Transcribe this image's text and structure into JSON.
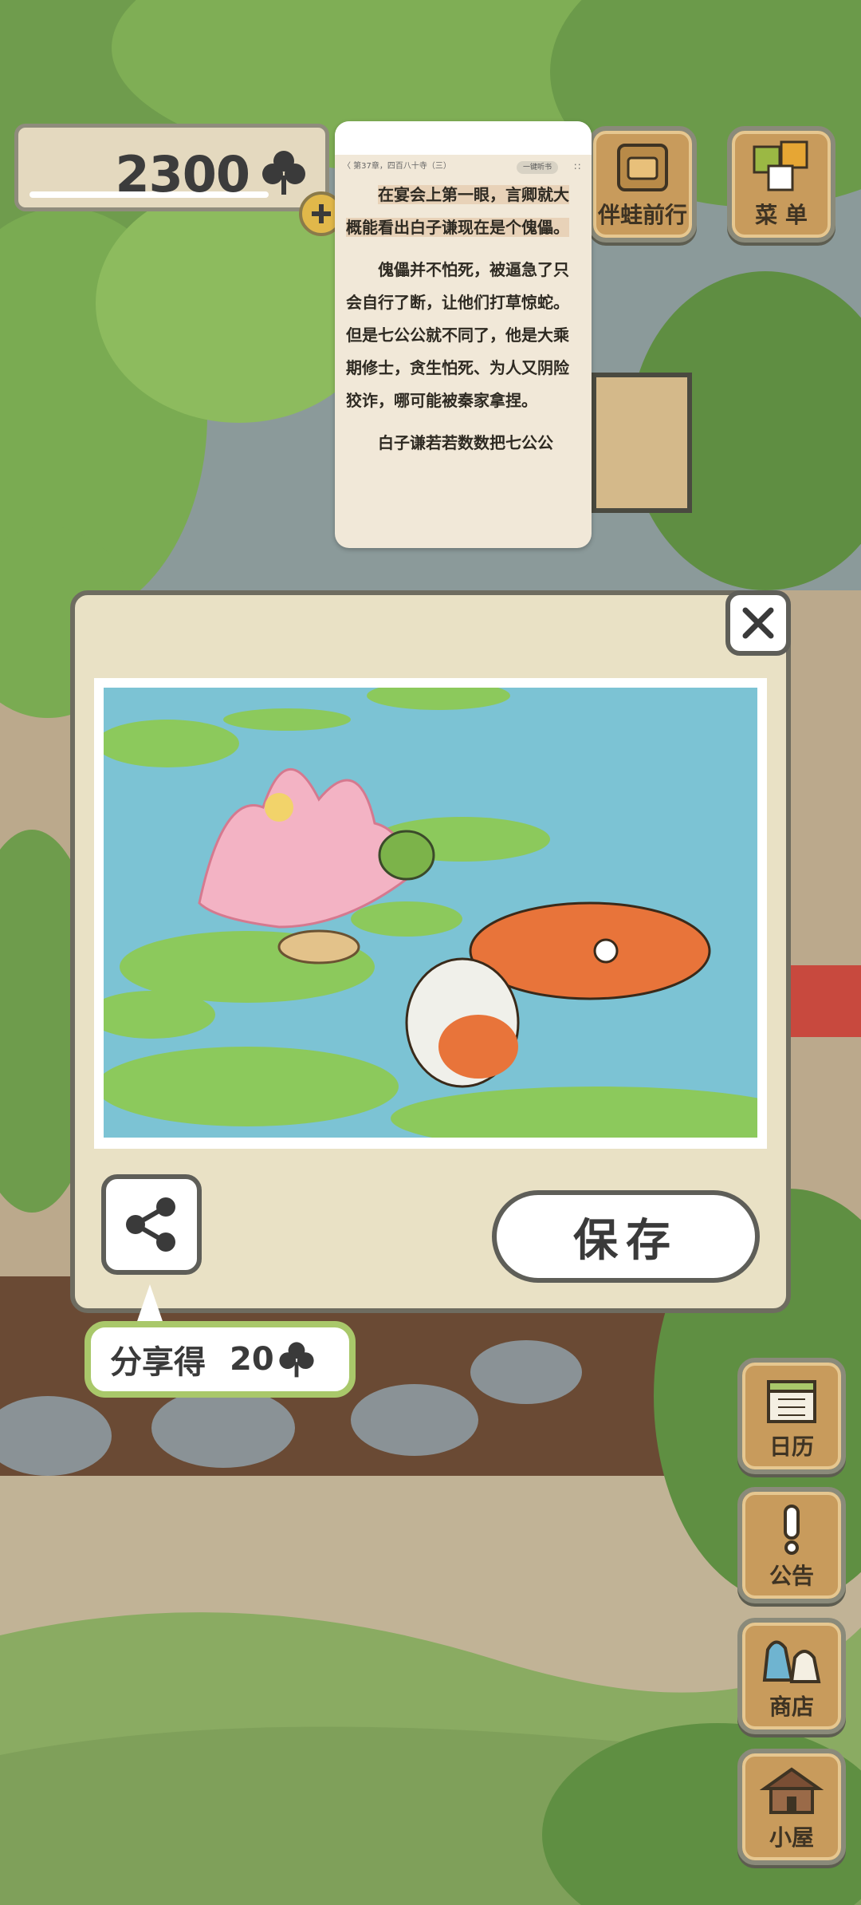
{
  "counter": {
    "clovers": "2300"
  },
  "reader": {
    "chapter_line": "〈 第37章，四百八十寺（三）",
    "pill_label": "一键听书",
    "para1_hl": "在宴会上第一眼，言卿就大概能看出白子谦现在是个傀儡。",
    "para2": "傀儡并不怕死，被逼急了只会自行了断，让他们打草惊蛇。但是七公公就不同了，他是大乘期修士，贪生怕死、为人又阴险狡诈，哪可能被秦家拿捏。",
    "para3_partial": "白子谦若若数数把七公公"
  },
  "top_buttons": {
    "companion": "伴蛙前行",
    "menu": "菜 单"
  },
  "dialog": {
    "save_label": "保存",
    "share_reward_text": "分享得",
    "share_reward_value": "20"
  },
  "side_buttons": [
    {
      "label": "日历",
      "icon": "calendar-icon"
    },
    {
      "label": "公告",
      "icon": "exclamation-icon"
    },
    {
      "label": "商店",
      "icon": "shop-bag-icon"
    },
    {
      "label": "小屋",
      "icon": "house-icon"
    }
  ],
  "colors": {
    "dialog_bg": "#e9e1c5",
    "tip_border": "#a9c86a",
    "wood": "#c89b5c"
  }
}
